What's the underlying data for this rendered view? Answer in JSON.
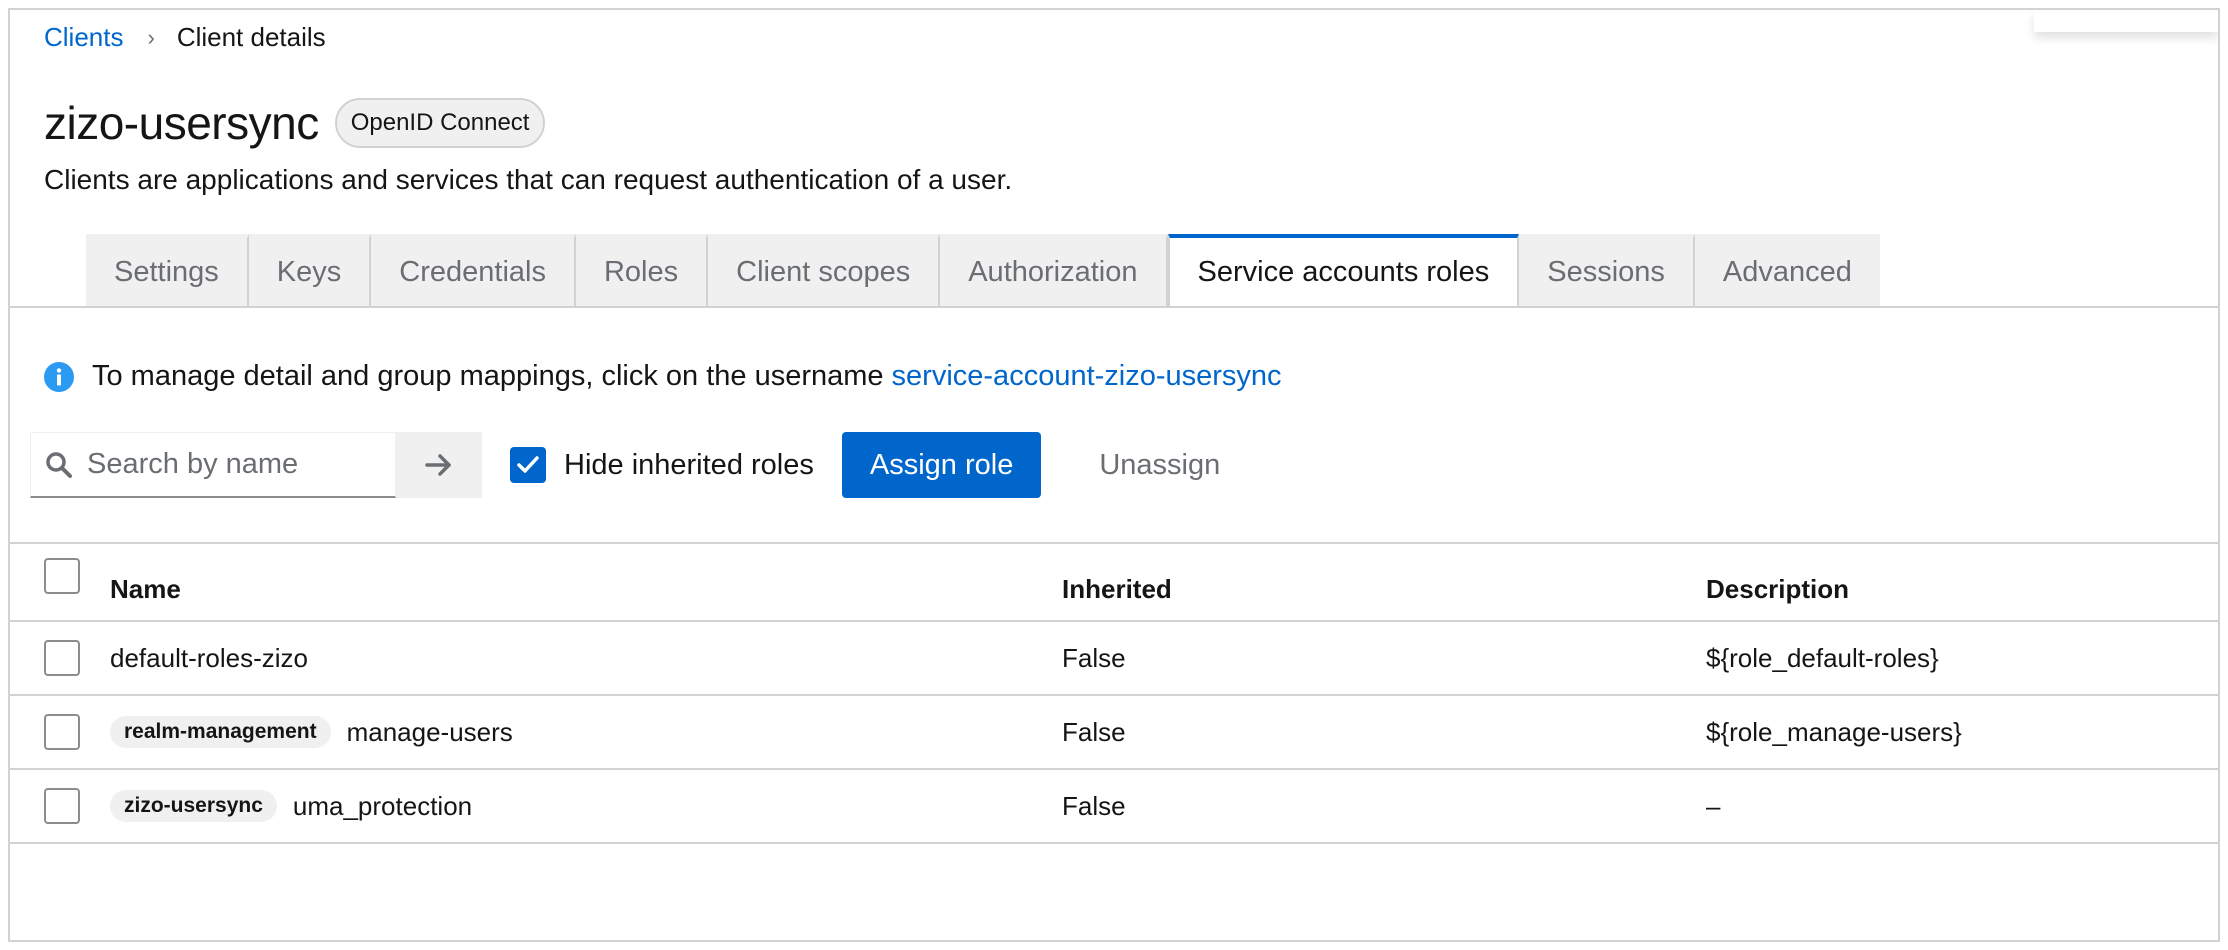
{
  "breadcrumb": {
    "clients_link": "Clients",
    "separator": "›",
    "current": "Client details"
  },
  "header": {
    "title": "zizo-usersync",
    "protocol_badge": "OpenID Connect",
    "subtitle": "Clients are applications and services that can request authentication of a user."
  },
  "tabs": [
    {
      "label": "Settings"
    },
    {
      "label": "Keys"
    },
    {
      "label": "Credentials"
    },
    {
      "label": "Roles"
    },
    {
      "label": "Client scopes"
    },
    {
      "label": "Authorization"
    },
    {
      "label": "Service accounts roles",
      "active": true
    },
    {
      "label": "Sessions"
    },
    {
      "label": "Advanced"
    }
  ],
  "info": {
    "text": "To manage detail and group mappings, click on the username",
    "link": "service-account-zizo-usersync",
    "icon": "info-circle-icon"
  },
  "toolbar": {
    "search_placeholder": "Search by name",
    "search_value": "",
    "hide_inherited_label": "Hide inherited roles",
    "hide_inherited_checked": true,
    "assign_label": "Assign role",
    "unassign_label": "Unassign"
  },
  "table": {
    "columns": [
      "Name",
      "Inherited",
      "Description"
    ],
    "rows": [
      {
        "client": "",
        "name": "default-roles-zizo",
        "inherited": "False",
        "description": "${role_default-roles}"
      },
      {
        "client": "realm-management",
        "name": "manage-users",
        "inherited": "False",
        "description": "${role_manage-users}"
      },
      {
        "client": "zizo-usersync",
        "name": "uma_protection",
        "inherited": "False",
        "description": "–"
      }
    ]
  },
  "colors": {
    "primary": "#0066cc",
    "border": "#d2d2d2",
    "muted": "#6a6e73",
    "tab_bg": "#f0f0f0"
  }
}
